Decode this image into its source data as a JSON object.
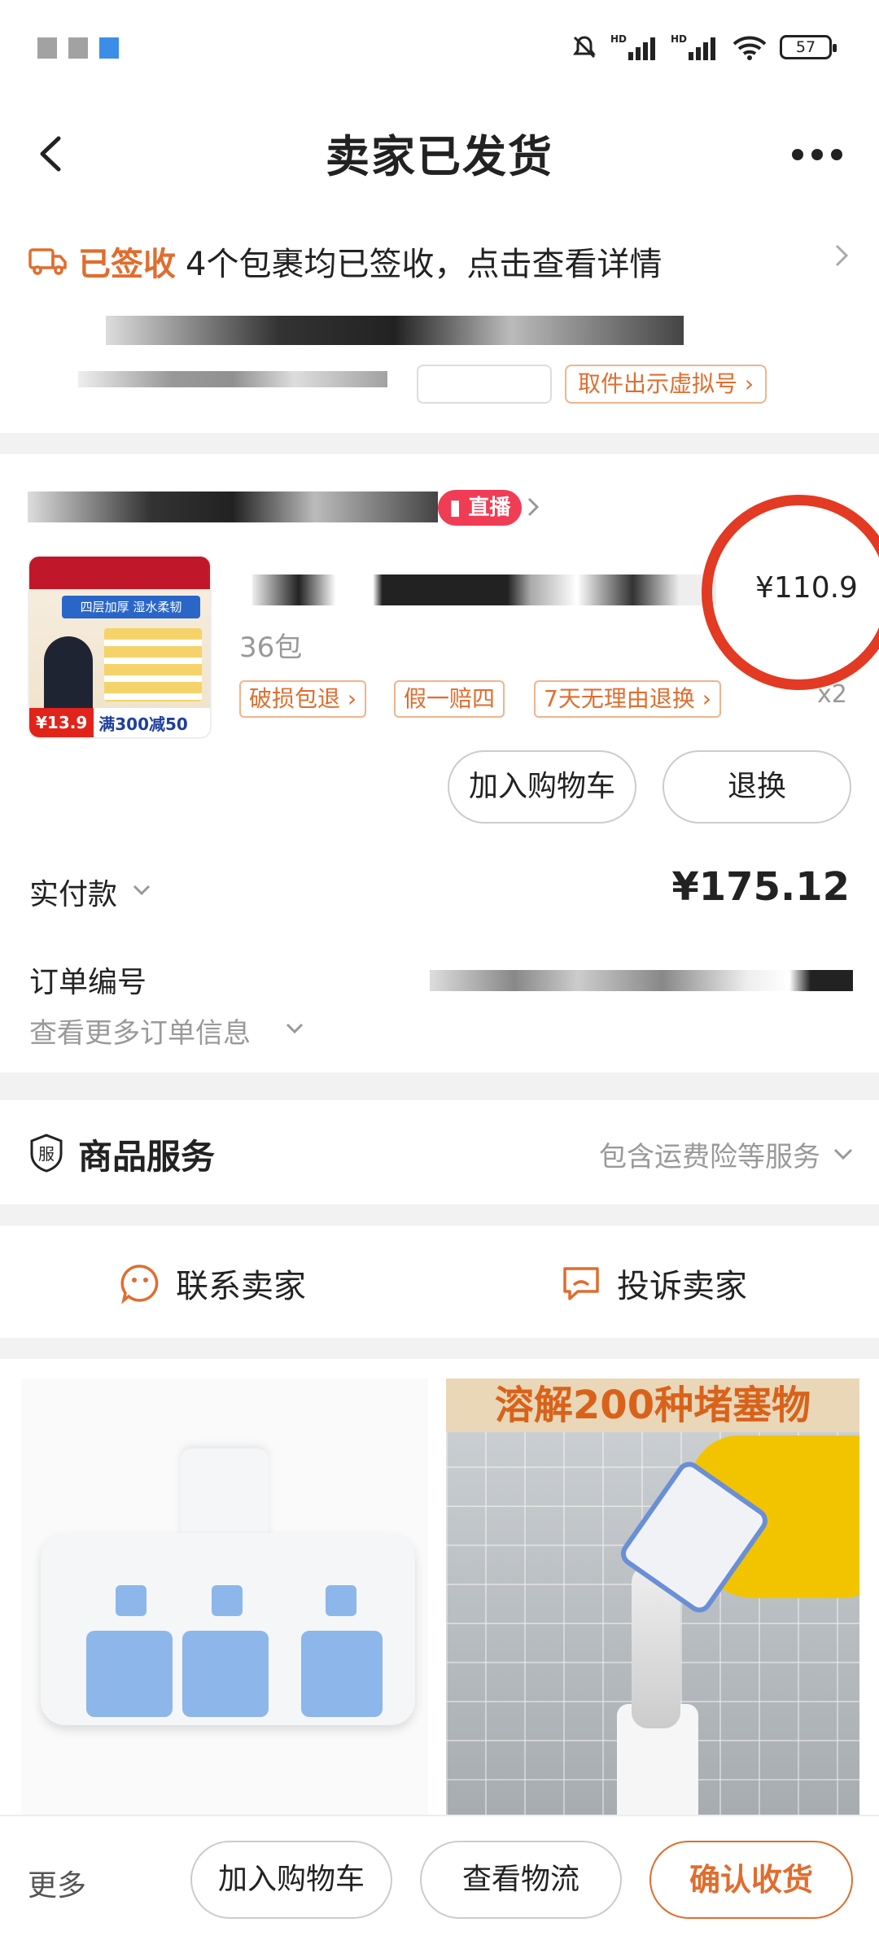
{
  "status_bar": {
    "battery": "57",
    "network_labels": [
      "HD",
      "HD"
    ]
  },
  "nav": {
    "title": "卖家已发货"
  },
  "shipping": {
    "status": "已签收",
    "description": "4个包裹均已签收，点击查看详情",
    "pickup_button": "取件出示虚拟号"
  },
  "order": {
    "live_badge": "直播",
    "product": {
      "spec": "36包",
      "price": "¥110.9",
      "quantity": "x2",
      "tags": [
        "破损包退",
        "假一赔四",
        "7天无理由退换"
      ],
      "image": {
        "banner": "四层加厚 湿水柔韧",
        "price_badge": "¥13.9",
        "promo": "满300减50"
      }
    },
    "add_to_cart": "加入购物车",
    "return_exchange": "退换",
    "paid_label": "实付款",
    "paid_value": "¥175.12",
    "order_no_label": "订单编号",
    "more_info": "查看更多订单信息"
  },
  "service": {
    "icon_glyph": "服",
    "title": "商品服务",
    "description": "包含运费险等服务"
  },
  "contact": {
    "seller": "联系卖家",
    "complain": "投诉卖家"
  },
  "recommendations": {
    "right_banner": "溶解200种堵塞物"
  },
  "bottom_bar": {
    "more": "更多",
    "add_to_cart": "加入购物车",
    "logistics": "查看物流",
    "confirm": "确认收货"
  },
  "colors": {
    "accent": "#e06d2e",
    "live_badge": "#f03c55",
    "annotation_circle": "#e23a23"
  }
}
